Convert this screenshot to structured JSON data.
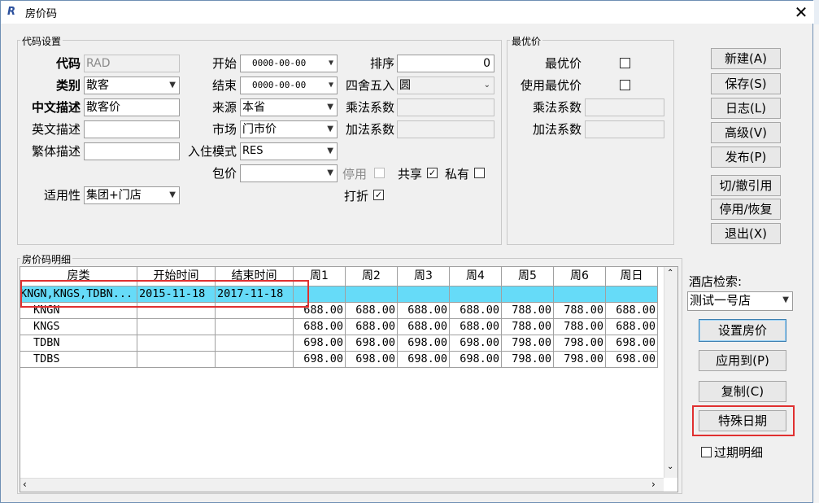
{
  "window": {
    "title": "房价码",
    "close_label": "✕"
  },
  "background_fragment": "",
  "code_settings": {
    "group_label": "代码设置",
    "code": {
      "label": "代码",
      "value": "RAD"
    },
    "category": {
      "label": "类别",
      "value": "散客"
    },
    "cn_desc": {
      "label": "中文描述",
      "value": "散客价"
    },
    "en_desc": {
      "label": "英文描述",
      "value": ""
    },
    "tw_desc": {
      "label": "繁体描述",
      "value": ""
    },
    "applicability": {
      "label": "适用性",
      "value": "集团+门店"
    },
    "start": {
      "label": "开始",
      "value": "0000-00-00"
    },
    "end": {
      "label": "结束",
      "value": "0000-00-00"
    },
    "source": {
      "label": "来源",
      "value": "本省"
    },
    "market": {
      "label": "市场",
      "value": "门市价"
    },
    "checkin_mode": {
      "label": "入住模式",
      "value": "RES"
    },
    "package": {
      "label": "包价",
      "value": ""
    },
    "sort": {
      "label": "排序",
      "value": "0"
    },
    "rounding": {
      "label": "四舍五入",
      "value": "圆"
    },
    "multiplier": {
      "label": "乘法系数",
      "value": ""
    },
    "addend": {
      "label": "加法系数",
      "value": ""
    },
    "disabled": {
      "label": "停用",
      "checked": false
    },
    "shared": {
      "label": "共享",
      "checked": true
    },
    "private": {
      "label": "私有",
      "checked": false
    },
    "discount": {
      "label": "打折",
      "checked": true
    }
  },
  "best_price": {
    "group_label": "最优价",
    "best": {
      "label": "最优价",
      "checked": false
    },
    "use_best": {
      "label": "使用最优价",
      "checked": false
    },
    "multiplier": {
      "label": "乘法系数",
      "value": ""
    },
    "addend": {
      "label": "加法系数",
      "value": ""
    }
  },
  "buttons": {
    "new": "新建(A)",
    "save": "保存(S)",
    "log": "日志(L)",
    "advanced": "高级(V)",
    "publish": "发布(P)",
    "toggle_ref": "切/撤引用",
    "disable_restore": "停用/恢复",
    "exit": "退出(X)"
  },
  "detail": {
    "group_label": "房价码明细",
    "columns": [
      "房类",
      "开始时间",
      "结束时间",
      "周1",
      "周2",
      "周3",
      "周4",
      "周5",
      "周6",
      "周日"
    ],
    "rows": [
      [
        "KNGN,KNGS,TDBN...",
        "2015-11-18",
        "2017-11-18",
        "",
        "",
        "",
        "",
        "",
        "",
        ""
      ],
      [
        "KNGN",
        "",
        "",
        "688.00",
        "688.00",
        "688.00",
        "688.00",
        "788.00",
        "788.00",
        "688.00"
      ],
      [
        "KNGS",
        "",
        "",
        "688.00",
        "688.00",
        "688.00",
        "688.00",
        "788.00",
        "788.00",
        "688.00"
      ],
      [
        "TDBN",
        "",
        "",
        "698.00",
        "698.00",
        "698.00",
        "698.00",
        "798.00",
        "798.00",
        "698.00"
      ],
      [
        "TDBS",
        "",
        "",
        "698.00",
        "698.00",
        "698.00",
        "698.00",
        "798.00",
        "798.00",
        "698.00"
      ]
    ]
  },
  "hotel_search": {
    "label": "酒店检索:",
    "value": "测试一号店"
  },
  "right_buttons": {
    "set_price": "设置房价",
    "apply_to": "应用到(P)",
    "copy": "复制(C)",
    "special_date": "特殊日期"
  },
  "expired_detail": {
    "label": "过期明细",
    "checked": false
  }
}
